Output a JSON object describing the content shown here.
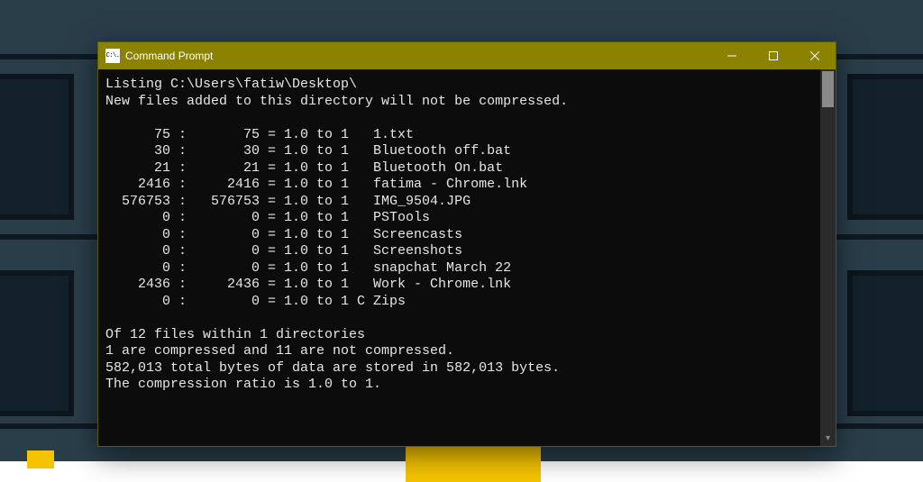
{
  "window": {
    "title": "Command Prompt",
    "icon_text": "C:\\."
  },
  "colors": {
    "titlebar": "#8a8200",
    "terminal_bg": "#0c0c0c",
    "terminal_fg": "#e6e6e6"
  },
  "listing": {
    "header_line": "Listing C:\\Users\\fatiw\\Desktop\\",
    "notice_line": "New files added to this directory will not be compressed.",
    "rows": [
      {
        "size1": "75",
        "size2": "75",
        "ratio": "1.0 to 1",
        "flag": " ",
        "name": "1.txt"
      },
      {
        "size1": "30",
        "size2": "30",
        "ratio": "1.0 to 1",
        "flag": " ",
        "name": "Bluetooth off.bat"
      },
      {
        "size1": "21",
        "size2": "21",
        "ratio": "1.0 to 1",
        "flag": " ",
        "name": "Bluetooth On.bat"
      },
      {
        "size1": "2416",
        "size2": "2416",
        "ratio": "1.0 to 1",
        "flag": " ",
        "name": "fatima - Chrome.lnk"
      },
      {
        "size1": "576753",
        "size2": "576753",
        "ratio": "1.0 to 1",
        "flag": " ",
        "name": "IMG_9504.JPG"
      },
      {
        "size1": "0",
        "size2": "0",
        "ratio": "1.0 to 1",
        "flag": " ",
        "name": "PSTools"
      },
      {
        "size1": "0",
        "size2": "0",
        "ratio": "1.0 to 1",
        "flag": " ",
        "name": "Screencasts"
      },
      {
        "size1": "0",
        "size2": "0",
        "ratio": "1.0 to 1",
        "flag": " ",
        "name": "Screenshots"
      },
      {
        "size1": "0",
        "size2": "0",
        "ratio": "1.0 to 1",
        "flag": " ",
        "name": "snapchat March 22"
      },
      {
        "size1": "2436",
        "size2": "2436",
        "ratio": "1.0 to 1",
        "flag": " ",
        "name": "Work - Chrome.lnk"
      },
      {
        "size1": "0",
        "size2": "0",
        "ratio": "1.0 to 1",
        "flag": "C",
        "name": "Zips"
      }
    ],
    "summary": [
      "Of 12 files within 1 directories",
      "1 are compressed and 11 are not compressed.",
      "582,013 total bytes of data are stored in 582,013 bytes.",
      "The compression ratio is 1.0 to 1."
    ]
  }
}
